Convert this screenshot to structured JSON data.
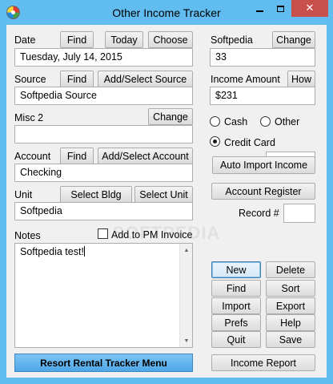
{
  "window": {
    "title": "Other Income Tracker",
    "close_glyph": "✕"
  },
  "date": {
    "label": "Date",
    "find": "Find",
    "today": "Today",
    "choose": "Choose",
    "value": "Tuesday, July 14, 2015"
  },
  "source": {
    "label": "Source",
    "find": "Find",
    "add_select": "Add/Select Source",
    "value": "Softpedia Source"
  },
  "misc2": {
    "label": "Misc 2",
    "change": "Change",
    "value": ""
  },
  "account": {
    "label": "Account",
    "find": "Find",
    "add_select": "Add/Select Account",
    "value": "Checking"
  },
  "unit": {
    "label": "Unit",
    "select_bldg": "Select Bldg",
    "select_unit": "Select Unit",
    "value": "Softpedia"
  },
  "notes": {
    "label": "Notes",
    "add_to_pm_invoice": "Add to PM Invoice",
    "value": "Softpedia test!"
  },
  "softpedia": {
    "label": "Softpedia",
    "change": "Change",
    "value": "33"
  },
  "income_amount": {
    "label": "Income Amount",
    "how": "How",
    "value": "$231"
  },
  "payment": {
    "cash": "Cash",
    "other": "Other",
    "credit_card": "Credit Card",
    "selected": "Credit Card"
  },
  "actions": {
    "auto_import_income": "Auto Import Income",
    "account_register": "Account Register",
    "record_label": "Record #",
    "record_value": "",
    "new": "New",
    "delete": "Delete",
    "find": "Find",
    "sort": "Sort",
    "import": "Import",
    "export": "Export",
    "prefs": "Prefs",
    "help": "Help",
    "quit": "Quit",
    "save": "Save",
    "income_report": "Income Report",
    "resort_menu": "Resort Rental Tracker Menu"
  },
  "watermark": "SOFTPEDIA"
}
